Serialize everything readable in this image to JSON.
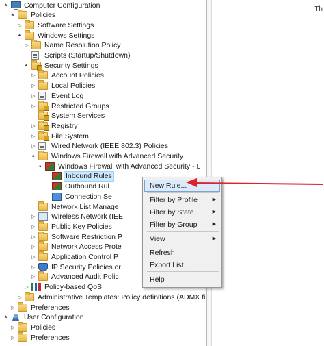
{
  "tree": [
    {
      "label": "Computer Configuration",
      "arrow": "▲",
      "icon": "computer"
    },
    {
      "label": "Policies",
      "arrow": "▲",
      "icon": "folder"
    },
    {
      "label": "Software Settings",
      "arrow": "▷",
      "icon": "folder"
    },
    {
      "label": "Windows Settings",
      "arrow": "▲",
      "icon": "folder"
    },
    {
      "label": "Name Resolution Policy",
      "arrow": "▷",
      "icon": "folder"
    },
    {
      "label": "Scripts (Startup/Shutdown)",
      "arrow": "",
      "icon": "doc"
    },
    {
      "label": "Security Settings",
      "arrow": "▲",
      "icon": "lock"
    },
    {
      "label": "Account Policies",
      "arrow": "▷",
      "icon": "folder"
    },
    {
      "label": "Local Policies",
      "arrow": "▷",
      "icon": "folder"
    },
    {
      "label": "Event Log",
      "arrow": "▷",
      "icon": "doc"
    },
    {
      "label": "Restricted Groups",
      "arrow": "▷",
      "icon": "lock"
    },
    {
      "label": "System Services",
      "arrow": "",
      "icon": "lock"
    },
    {
      "label": "Registry",
      "arrow": "▷",
      "icon": "lock"
    },
    {
      "label": "File System",
      "arrow": "▷",
      "icon": "lock"
    },
    {
      "label": "Wired Network (IEEE 802.3) Policies",
      "arrow": "▷",
      "icon": "doc"
    },
    {
      "label": "Windows Firewall with Advanced Security",
      "arrow": "▲",
      "icon": "folder"
    },
    {
      "label": "Windows Firewall with Advanced Security - L",
      "arrow": "▲",
      "icon": "fw"
    },
    {
      "label": "Inbound Rules",
      "arrow": "",
      "icon": "fw"
    },
    {
      "label": "Outbound Rul",
      "arrow": "",
      "icon": "fw"
    },
    {
      "label": "Connection Se",
      "arrow": "",
      "icon": "net"
    },
    {
      "label": "Network List Manage",
      "arrow": "",
      "icon": "folder"
    },
    {
      "label": "Wireless Network (IEE",
      "arrow": "▷",
      "icon": "wifi"
    },
    {
      "label": "Public Key Policies",
      "arrow": "▷",
      "icon": "folder"
    },
    {
      "label": "Software Restriction P",
      "arrow": "▷",
      "icon": "folder"
    },
    {
      "label": "Network Access Prote",
      "arrow": "▷",
      "icon": "folder"
    },
    {
      "label": "Application Control P",
      "arrow": "▷",
      "icon": "folder"
    },
    {
      "label": "IP Security Policies or",
      "arrow": "▷",
      "icon": "shield"
    },
    {
      "label": "Advanced Audit Polic",
      "arrow": "▷",
      "icon": "folder"
    },
    {
      "label": "Policy-based QoS",
      "arrow": "▷",
      "icon": "bars"
    },
    {
      "label": "Administrative Templates: Policy definitions (ADMX file",
      "arrow": "▷",
      "icon": "folder"
    },
    {
      "label": "Preferences",
      "arrow": "▷",
      "icon": "folder"
    },
    {
      "label": "User Configuration",
      "arrow": "▲",
      "icon": "user"
    },
    {
      "label": "Policies",
      "arrow": "▷",
      "icon": "folder"
    },
    {
      "label": "Preferences",
      "arrow": "▷",
      "icon": "folder"
    }
  ],
  "selected_index": 17,
  "right_pane_fragment": "Th",
  "context_menu": {
    "items": [
      {
        "label": "New Rule...",
        "submenu": false,
        "highlighted": true
      },
      {
        "label": "Filter by Profile",
        "submenu": true
      },
      {
        "label": "Filter by State",
        "submenu": true
      },
      {
        "label": "Filter by Group",
        "submenu": true
      },
      {
        "label": "View",
        "submenu": true
      },
      {
        "label": "Refresh",
        "submenu": false
      },
      {
        "label": "Export List...",
        "submenu": false
      },
      {
        "label": "Help",
        "submenu": false
      }
    ]
  },
  "colors": {
    "selection_bg": "#cce8ff",
    "menu_highlight": "#dcebfc",
    "annotation_arrow": "#e0202a"
  }
}
